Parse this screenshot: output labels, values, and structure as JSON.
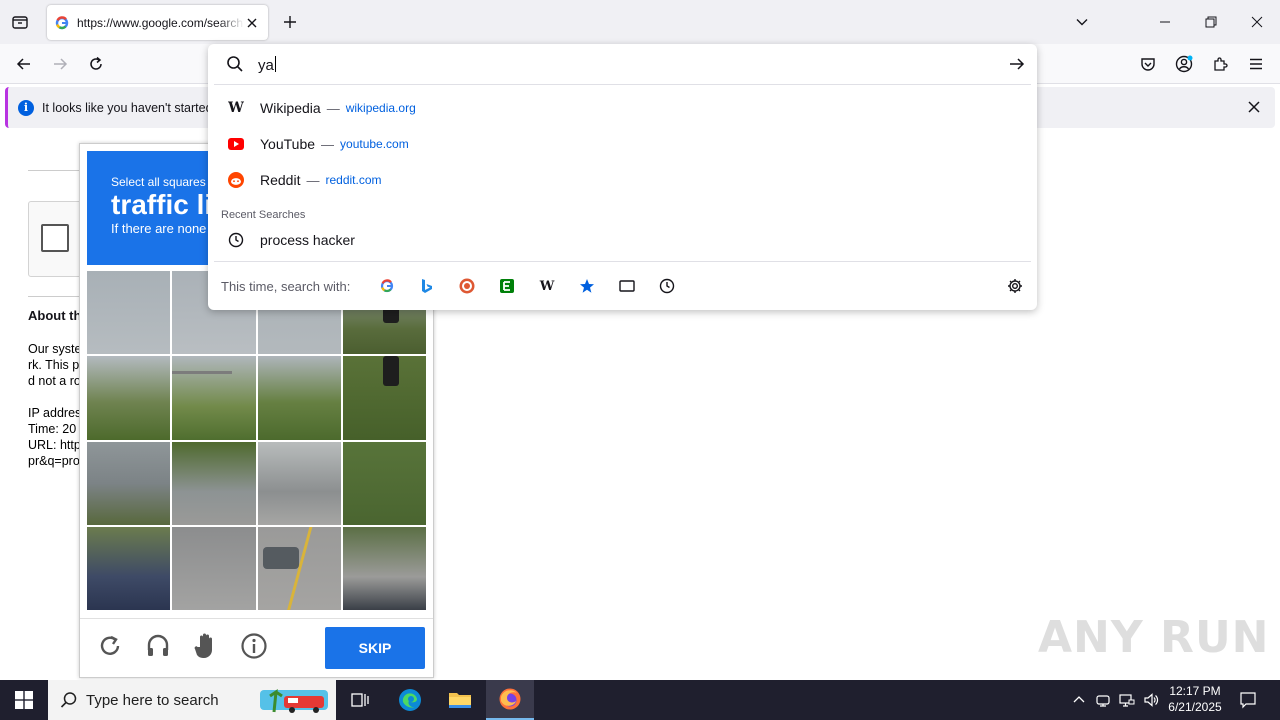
{
  "tab": {
    "title": "https://www.google.com/search?q="
  },
  "notification": {
    "text": "It looks like you haven't started"
  },
  "urlbar": {
    "value": "ya"
  },
  "suggestions": [
    {
      "name": "Wikipedia",
      "url": "wikipedia.org",
      "icon": "wikipedia-icon"
    },
    {
      "name": "YouTube",
      "url": "youtube.com",
      "icon": "youtube-icon"
    },
    {
      "name": "Reddit",
      "url": "reddit.com",
      "icon": "reddit-icon"
    }
  ],
  "recent": {
    "heading": "Recent Searches",
    "items": [
      "process hacker"
    ]
  },
  "oneoff": {
    "label": "This time, search with:",
    "engines": [
      "google",
      "bing",
      "duckduckgo",
      "ecosia",
      "wikipedia",
      "bookmarks",
      "tabs",
      "history"
    ]
  },
  "page": {
    "about": "About th",
    "lines1": [
      "Our syste",
      "rk. This p",
      "d not a ro"
    ],
    "lines2": [
      "IP addres",
      "Time: 20",
      "URL: http",
      "pr&q=pro"
    ]
  },
  "captcha": {
    "line1": "Select all squares",
    "line2": "traffic li",
    "line3": "If there are none",
    "skip": "SKIP"
  },
  "watermark": "ANY RUN",
  "taskbar": {
    "search_placeholder": "Type here to search",
    "time": "12:17 PM",
    "date": "6/21/2025"
  },
  "colors": {
    "accent": "#0060df",
    "captcha_blue": "#1a73e8",
    "notification_accent": "#b833e1",
    "taskbar": "#1f1f2e"
  }
}
